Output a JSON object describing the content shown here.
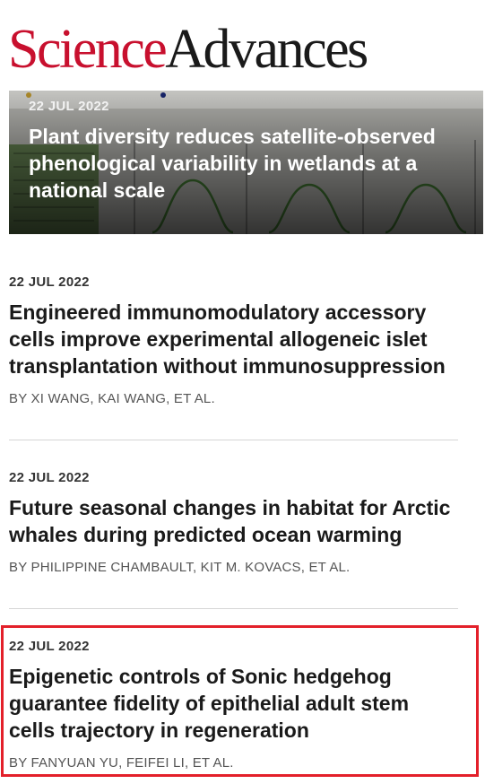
{
  "brand": {
    "name_part1": "Science",
    "name_part2": "Advances",
    "color_primary": "#c8102e"
  },
  "hero": {
    "date": "22 JUL 2022",
    "title": "Plant diversity reduces satellite-observed phenological variability in wetlands at a national scale"
  },
  "articles": [
    {
      "date": "22 JUL 2022",
      "title": "Engineered immunomodulatory accessory cells improve experimental allogeneic islet transplantation without immunosuppression",
      "authors": "BY XI WANG, KAI WANG, ET AL."
    },
    {
      "date": "22 JUL 2022",
      "title": "Future seasonal changes in habitat for Arctic whales during predicted ocean warming",
      "authors": "BY PHILIPPINE CHAMBAULT, KIT M. KOVACS, ET AL."
    },
    {
      "date": "22 JUL 2022",
      "title": "Epigenetic controls of Sonic hedgehog guarantee fidelity of epithelial adult stem cells trajectory in regeneration",
      "authors": "BY FANYUAN YU, FEIFEI LI, ET AL.",
      "highlighted": true
    }
  ],
  "colors": {
    "highlight_border": "#e3202a"
  }
}
